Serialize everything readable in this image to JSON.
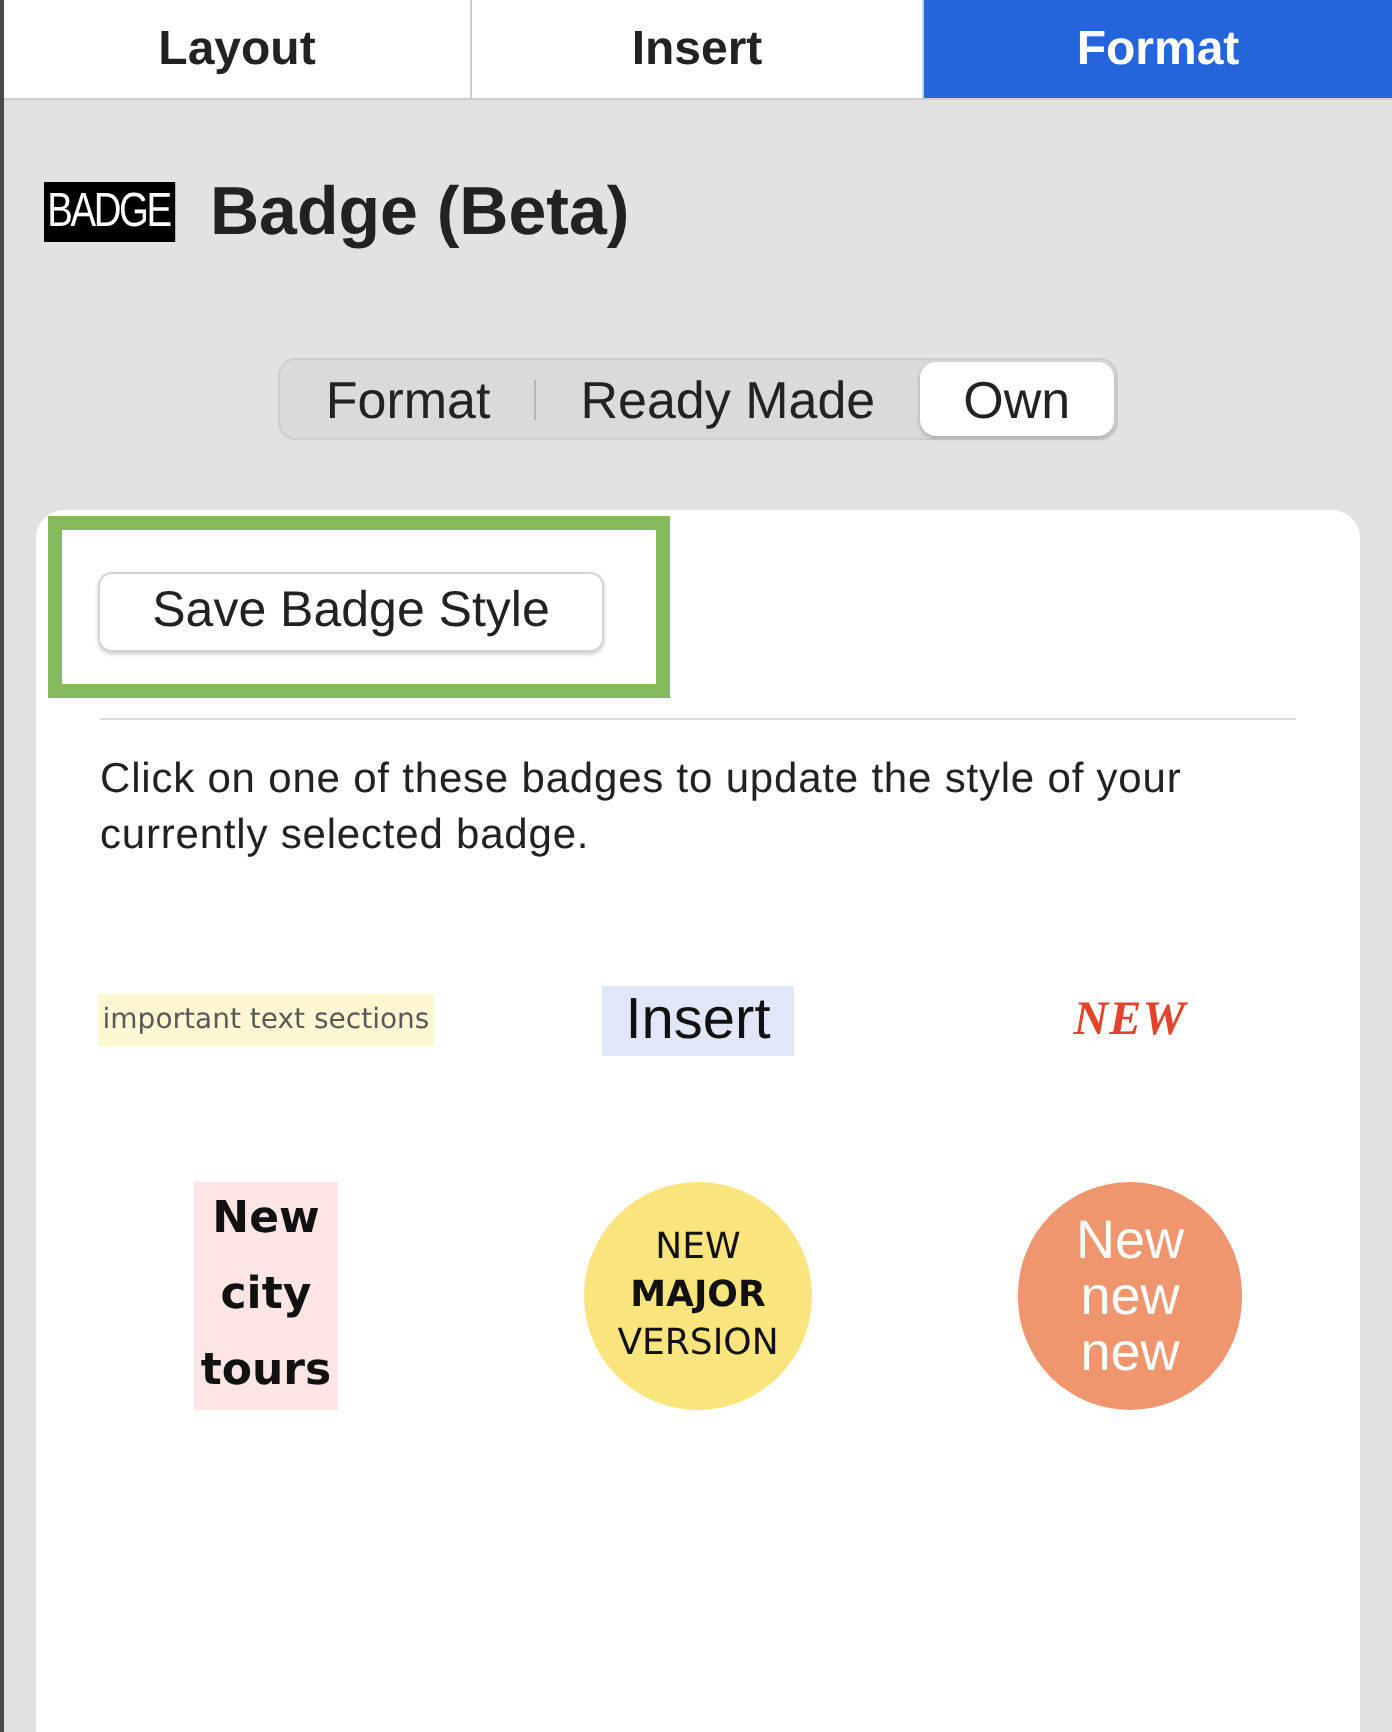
{
  "tabs": [
    {
      "label": "Layout",
      "selected": false
    },
    {
      "label": "Insert",
      "selected": false
    },
    {
      "label": "Format",
      "selected": true
    }
  ],
  "header": {
    "logo": "BADGE",
    "title": "Badge (Beta)"
  },
  "segments": [
    {
      "label": "Format",
      "selected": false
    },
    {
      "label": "Ready Made",
      "selected": false
    },
    {
      "label": "Own",
      "selected": true
    }
  ],
  "panel": {
    "save_button": "Save Badge Style",
    "highlighted": true,
    "instructions": "Click on one of these badges to update the style of your currently selected badge.",
    "badges": [
      {
        "kind": "marker",
        "text": "important text sections"
      },
      {
        "kind": "tag",
        "text": "Insert"
      },
      {
        "kind": "script",
        "text": "NEW"
      },
      {
        "kind": "block",
        "text": "New city tours"
      },
      {
        "kind": "seal",
        "text": "NEW **MAJOR** VERSION"
      },
      {
        "kind": "bubble",
        "text": "New new new"
      }
    ]
  }
}
